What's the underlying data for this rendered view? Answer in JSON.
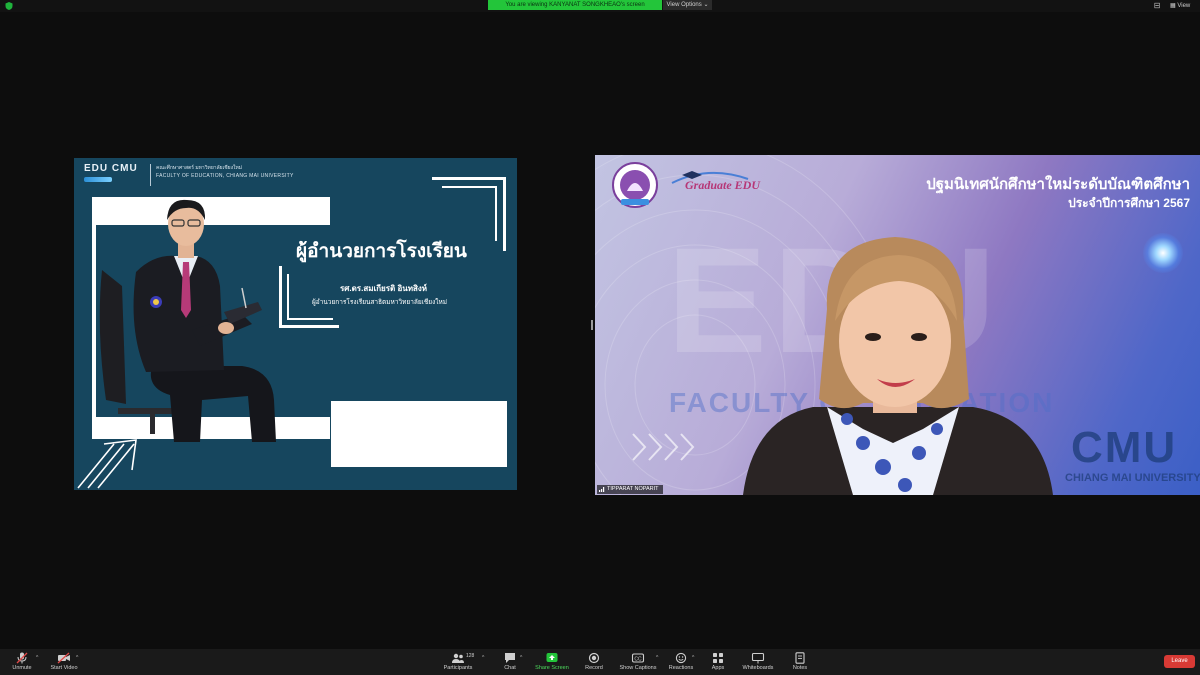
{
  "topbar": {
    "banner": "You are viewing KANYANAT SONGKHEAO's screen",
    "view_options": "View Options",
    "view": "View"
  },
  "slide": {
    "logo": "EDU CMU",
    "faculty_th": "คณะศึกษาศาสตร์ มหาวิทยาลัยเชียงใหม่",
    "faculty_en": "FACULTY OF EDUCATION, CHIANG MAI UNIVERSITY",
    "title": "ผู้อำนวยการโรงเรียน",
    "person_name": "รศ.ดร.สมเกียรติ  อินทสิงห์",
    "person_role": "ผู้อำนวยการโรงเรียนสาธิตมหาวิทยาลัยเชียงใหม่"
  },
  "video": {
    "header_th": "ปฐมนิเทศนักศึกษาใหม่ระดับบัณฑิตศึกษา",
    "year": "ประจำปีการศึกษา 2567",
    "graduate": "Graduate EDU",
    "bg_edu": "EDU",
    "bg_faculty": "FACULTY OF EDUCATION",
    "bg_cmu": "CMU",
    "bg_university": "CHIANG MAI UNIVERSITY",
    "participant_name": "TIPPARAT NOPARIT"
  },
  "toolbar": {
    "unmute": "Unmute",
    "start_video": "Start Video",
    "participants": "Participants",
    "participant_count": "128",
    "chat": "Chat",
    "share_screen": "Share Screen",
    "record": "Record",
    "show_captions": "Show Captions",
    "reactions": "Reactions",
    "apps": "Apps",
    "whiteboards": "Whiteboards",
    "notes": "Notes",
    "leave": "Leave"
  },
  "colors": {
    "share_banner": "#23c53a",
    "slide_bg": "#16465e",
    "leave": "#d83a35"
  }
}
